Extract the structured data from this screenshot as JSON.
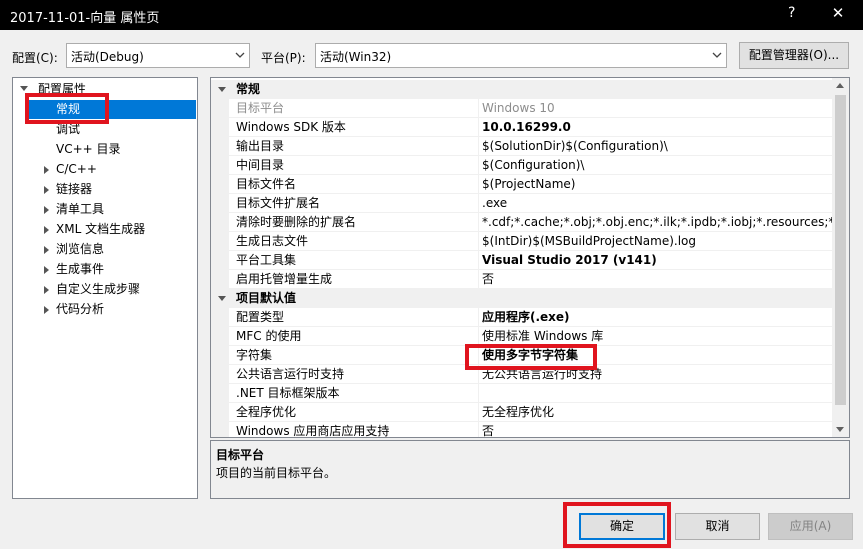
{
  "window": {
    "title": "2017-11-01-向量 属性页",
    "help": "?",
    "close": "✕"
  },
  "config": {
    "config_label": "配置(C):",
    "config_value": "活动(Debug)",
    "platform_label": "平台(P):",
    "platform_value": "活动(Win32)",
    "manager_button": "配置管理器(O)..."
  },
  "tree": {
    "root": "配置属性",
    "items": [
      "常规",
      "调试",
      "VC++ 目录",
      "C/C++",
      "链接器",
      "清单工具",
      "XML 文档生成器",
      "浏览信息",
      "生成事件",
      "自定义生成步骤",
      "代码分析"
    ]
  },
  "grid": {
    "cat1": "常规",
    "general": [
      {
        "name": "目标平台",
        "value": "Windows 10"
      },
      {
        "name": "Windows SDK 版本",
        "value": "10.0.16299.0"
      },
      {
        "name": "输出目录",
        "value": "$(SolutionDir)$(Configuration)\\"
      },
      {
        "name": "中间目录",
        "value": "$(Configuration)\\"
      },
      {
        "name": "目标文件名",
        "value": "$(ProjectName)"
      },
      {
        "name": "目标文件扩展名",
        "value": ".exe"
      },
      {
        "name": "清除时要删除的扩展名",
        "value": "*.cdf;*.cache;*.obj;*.obj.enc;*.ilk;*.ipdb;*.iobj;*.resources;*.tlb;*.tli;*"
      },
      {
        "name": "生成日志文件",
        "value": "$(IntDir)$(MSBuildProjectName).log"
      },
      {
        "name": "平台工具集",
        "value": "Visual Studio 2017 (v141)"
      },
      {
        "name": "启用托管增量生成",
        "value": "否"
      }
    ],
    "cat2": "项目默认值",
    "defaults": [
      {
        "name": "配置类型",
        "value": "应用程序(.exe)"
      },
      {
        "name": "MFC 的使用",
        "value": "使用标准 Windows 库"
      },
      {
        "name": "字符集",
        "value": "使用多字节字符集"
      },
      {
        "name": "公共语言运行时支持",
        "value": "无公共语言运行时支持"
      },
      {
        "name": ".NET 目标框架版本",
        "value": ""
      },
      {
        "name": "全程序优化",
        "value": "无全程序优化"
      },
      {
        "name": "Windows 应用商店应用支持",
        "value": "否"
      }
    ]
  },
  "description": {
    "title": "目标平台",
    "text": "项目的当前目标平台。"
  },
  "buttons": {
    "ok": "确定",
    "cancel": "取消",
    "apply": "应用(A)"
  },
  "colors": {
    "highlight": "#e0141e",
    "selection": "#0078d7"
  }
}
